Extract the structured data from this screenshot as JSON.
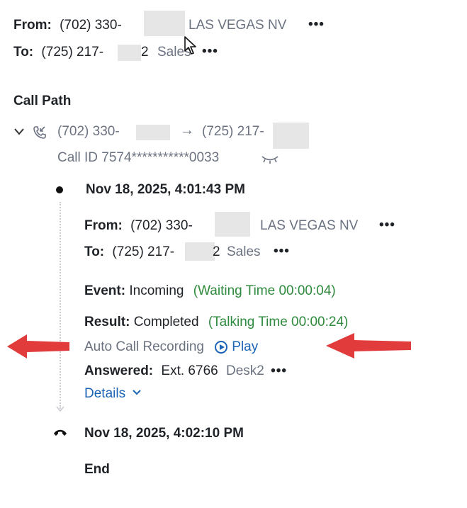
{
  "header": {
    "from_label": "From:",
    "from_number": "(702) 330-",
    "from_location": "LAS VEGAS NV",
    "to_label": "To:",
    "to_number": "(725) 217-",
    "to_suffix": "2",
    "to_name": "Sales",
    "more": "•••"
  },
  "call_path": {
    "title": "Call Path",
    "from_number": "(702) 330-",
    "arrow": "→",
    "to_number": "(725) 217-",
    "call_id": "Call ID 7574***********0033"
  },
  "event1": {
    "timestamp": "Nov 18, 2025, 4:01:43 PM",
    "from_label": "From:",
    "from_number": "(702) 330-",
    "from_location": "LAS VEGAS NV",
    "to_label": "To:",
    "to_number": "(725) 217-",
    "to_suffix": "2",
    "to_name": "Sales",
    "event_label": "Event:",
    "event_value": "Incoming",
    "waiting_time": "(Waiting Time 00:00:04)",
    "result_label": "Result:",
    "result_value": "Completed",
    "talking_time": "(Talking Time 00:00:24)",
    "recording_label": "Auto Call Recording",
    "play_label": "Play",
    "answered_label": "Answered:",
    "answered_ext": "Ext. 6766",
    "answered_device": "Desk2",
    "details_label": "Details"
  },
  "event2": {
    "timestamp": "Nov 18, 2025, 4:02:10 PM",
    "end_label": "End"
  },
  "colors": {
    "green": "#2f8a3e",
    "blue": "#1a63b5",
    "arrow_red": "#e23b3b"
  }
}
